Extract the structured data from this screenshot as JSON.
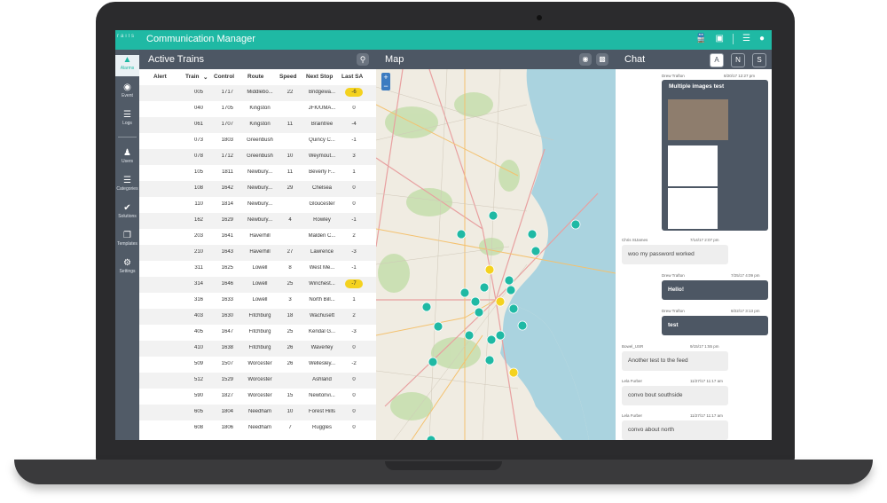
{
  "app": {
    "title": "Communication Manager",
    "logo": "rails"
  },
  "topbar_icons": [
    "train-icon",
    "map-icon",
    "list-icon",
    "user-icon"
  ],
  "sidebar": {
    "items": [
      {
        "label": "Alarms",
        "icon": "alarm-icon",
        "active": true
      },
      {
        "label": "Event",
        "icon": "info-icon"
      },
      {
        "label": "Logs",
        "icon": "list-icon"
      },
      {
        "label": "Users",
        "icon": "users-icon"
      },
      {
        "label": "Categories",
        "icon": "categories-icon"
      },
      {
        "label": "Solutions",
        "icon": "check-icon"
      },
      {
        "label": "Templates",
        "icon": "templates-icon"
      },
      {
        "label": "Settings",
        "icon": "gear-icon"
      }
    ]
  },
  "trains_panel": {
    "title": "Active Trains",
    "columns": {
      "alert": "Alert",
      "train": "Train",
      "control": "Control",
      "route": "Route",
      "speed": "Speed",
      "next_stop": "Next Stop",
      "last_sa": "Last SA"
    },
    "rows": [
      {
        "train": "005",
        "control": "1717",
        "route": "Middlebo...",
        "speed": "22",
        "next": "Bridgewa...",
        "sa": "-6",
        "warn": true
      },
      {
        "train": "040",
        "control": "1705",
        "route": "Kingston",
        "speed": "",
        "next": "JFK/UMA...",
        "sa": "0"
      },
      {
        "train": "061",
        "control": "1707",
        "route": "Kingston",
        "speed": "11",
        "next": "Braintree",
        "sa": "-4"
      },
      {
        "train": "073",
        "control": "1803",
        "route": "Greenbush",
        "speed": "",
        "next": "Quincy C...",
        "sa": "-1"
      },
      {
        "train": "078",
        "control": "1712",
        "route": "Greenbush",
        "speed": "10",
        "next": "Weymout...",
        "sa": "3"
      },
      {
        "train": "105",
        "control": "1811",
        "route": "Newbury...",
        "speed": "11",
        "next": "Beverly F...",
        "sa": "1"
      },
      {
        "train": "108",
        "control": "1642",
        "route": "Newbury...",
        "speed": "29",
        "next": "Chelsea",
        "sa": "0"
      },
      {
        "train": "110",
        "control": "1814",
        "route": "Newbury...",
        "speed": "",
        "next": "Gloucester",
        "sa": "0"
      },
      {
        "train": "162",
        "control": "1629",
        "route": "Newbury...",
        "speed": "4",
        "next": "Rowley",
        "sa": "-1"
      },
      {
        "train": "203",
        "control": "1641",
        "route": "Haverhill",
        "speed": "",
        "next": "Malden C...",
        "sa": "2"
      },
      {
        "train": "210",
        "control": "1643",
        "route": "Haverhill",
        "speed": "27",
        "next": "Lawrence",
        "sa": "-3"
      },
      {
        "train": "311",
        "control": "1625",
        "route": "Lowell",
        "speed": "8",
        "next": "West Me...",
        "sa": "-1"
      },
      {
        "train": "314",
        "control": "1646",
        "route": "Lowell",
        "speed": "25",
        "next": "Winchest...",
        "sa": "-7",
        "warn": true
      },
      {
        "train": "316",
        "control": "1633",
        "route": "Lowell",
        "speed": "3",
        "next": "North Bill...",
        "sa": "1"
      },
      {
        "train": "403",
        "control": "1630",
        "route": "Fitchburg",
        "speed": "18",
        "next": "Wachusett",
        "sa": "2"
      },
      {
        "train": "405",
        "control": "1647",
        "route": "Fitchburg",
        "speed": "25",
        "next": "Kendal G...",
        "sa": "-3"
      },
      {
        "train": "410",
        "control": "1638",
        "route": "Fitchburg",
        "speed": "26",
        "next": "Waverley",
        "sa": "0"
      },
      {
        "train": "509",
        "control": "1507",
        "route": "Worcester",
        "speed": "26",
        "next": "Wellesley...",
        "sa": "-2"
      },
      {
        "train": "512",
        "control": "1529",
        "route": "Worcester",
        "speed": "",
        "next": "Ashland",
        "sa": "0"
      },
      {
        "train": "590",
        "control": "1827",
        "route": "Worcester",
        "speed": "15",
        "next": "Newtonvi...",
        "sa": "0"
      },
      {
        "train": "605",
        "control": "1804",
        "route": "Needham",
        "speed": "10",
        "next": "Forest Hills",
        "sa": "0"
      },
      {
        "train": "608",
        "control": "1806",
        "route": "Needham",
        "speed": "7",
        "next": "Ruggles",
        "sa": "0"
      }
    ]
  },
  "map_panel": {
    "title": "Map",
    "zoom_in": "+",
    "zoom_out": "−"
  },
  "chat_panel": {
    "title": "Chat",
    "tabs": [
      "A",
      "N",
      "S"
    ],
    "messages": [
      {
        "author": "Drew Trafton",
        "time": "8/20/17 12:27 pm",
        "text": "Multiple images test",
        "out": true
      },
      {
        "author": "Chris StJames",
        "time": "7/14/17 2:07 pm",
        "text": "woo my password worked"
      },
      {
        "author": "Drew Trafton",
        "time": "7/25/17 4:09 pm",
        "text": "Hello!",
        "out": true
      },
      {
        "author": "Drew Trafton",
        "time": "8/22/17 3:13 pm",
        "text": "test",
        "out": true
      },
      {
        "author": "Bowel_USR",
        "time": "9/15/17 1:55 pm",
        "text": "Another test to the feed"
      },
      {
        "author": "Lela Furber",
        "time": "11/27/17 11:17 am",
        "text": "convo bout southside"
      },
      {
        "author": "Lela Furber",
        "time": "11/27/17 11:17 am",
        "text": "convo about north"
      }
    ]
  },
  "colors": {
    "accent": "#1fb9a4",
    "panel_header": "#4d5764",
    "sidebar": "#515b67",
    "warn": "#f4d21f"
  }
}
